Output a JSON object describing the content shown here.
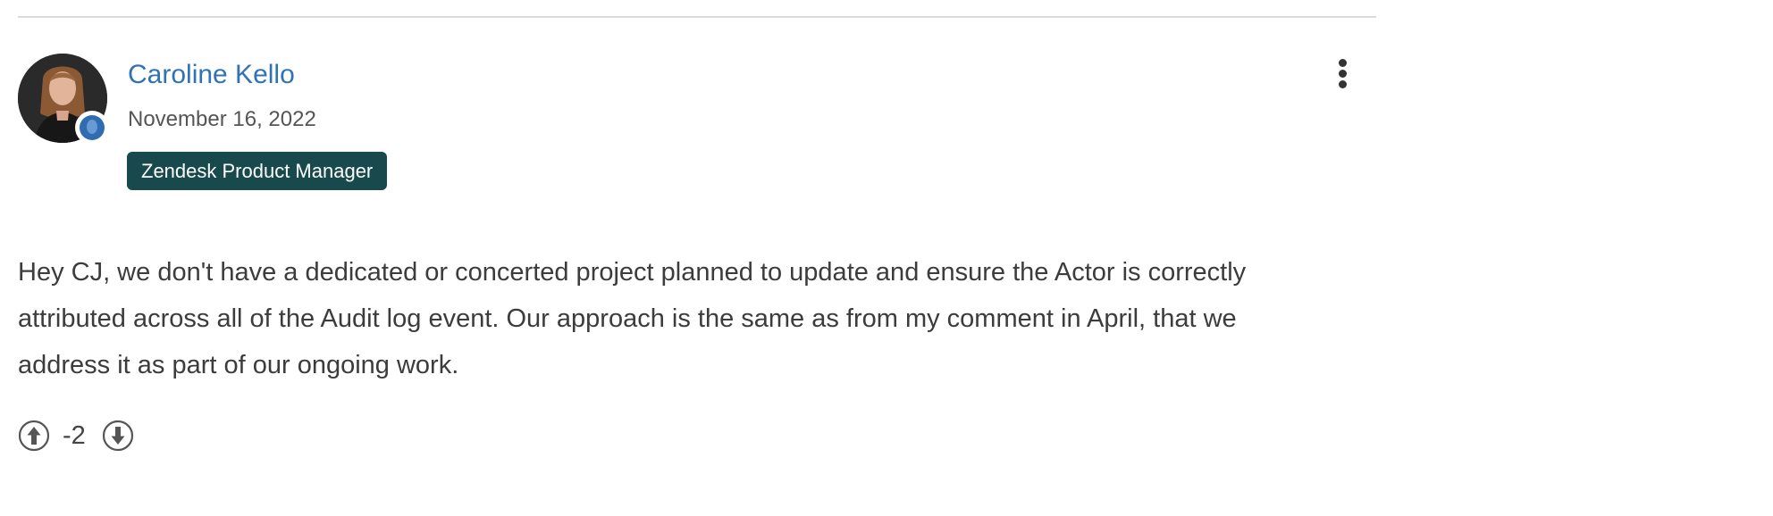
{
  "comment": {
    "author": {
      "name": "Caroline Kello",
      "date": "November 16, 2022",
      "badge": "Zendesk Product Manager"
    },
    "body": "Hey CJ, we don't have a dedicated or concerted project planned to update and ensure the Actor is correctly attributed across all of the Audit log event. Our approach is the same as from my comment in April, that we address it as part of our ongoing work.",
    "votes": {
      "count": "-2",
      "upvote_icon": "arrow-up-circle-icon",
      "downvote_icon": "arrow-down-circle-icon"
    },
    "actions": {
      "menu_icon": "vertical-ellipsis-icon"
    }
  },
  "colors": {
    "author_link": "#2f73b5",
    "badge_background": "#17494d",
    "badge_text": "#ffffff",
    "role_dot": "#2f6db2",
    "divider": "#dcdcdc"
  }
}
